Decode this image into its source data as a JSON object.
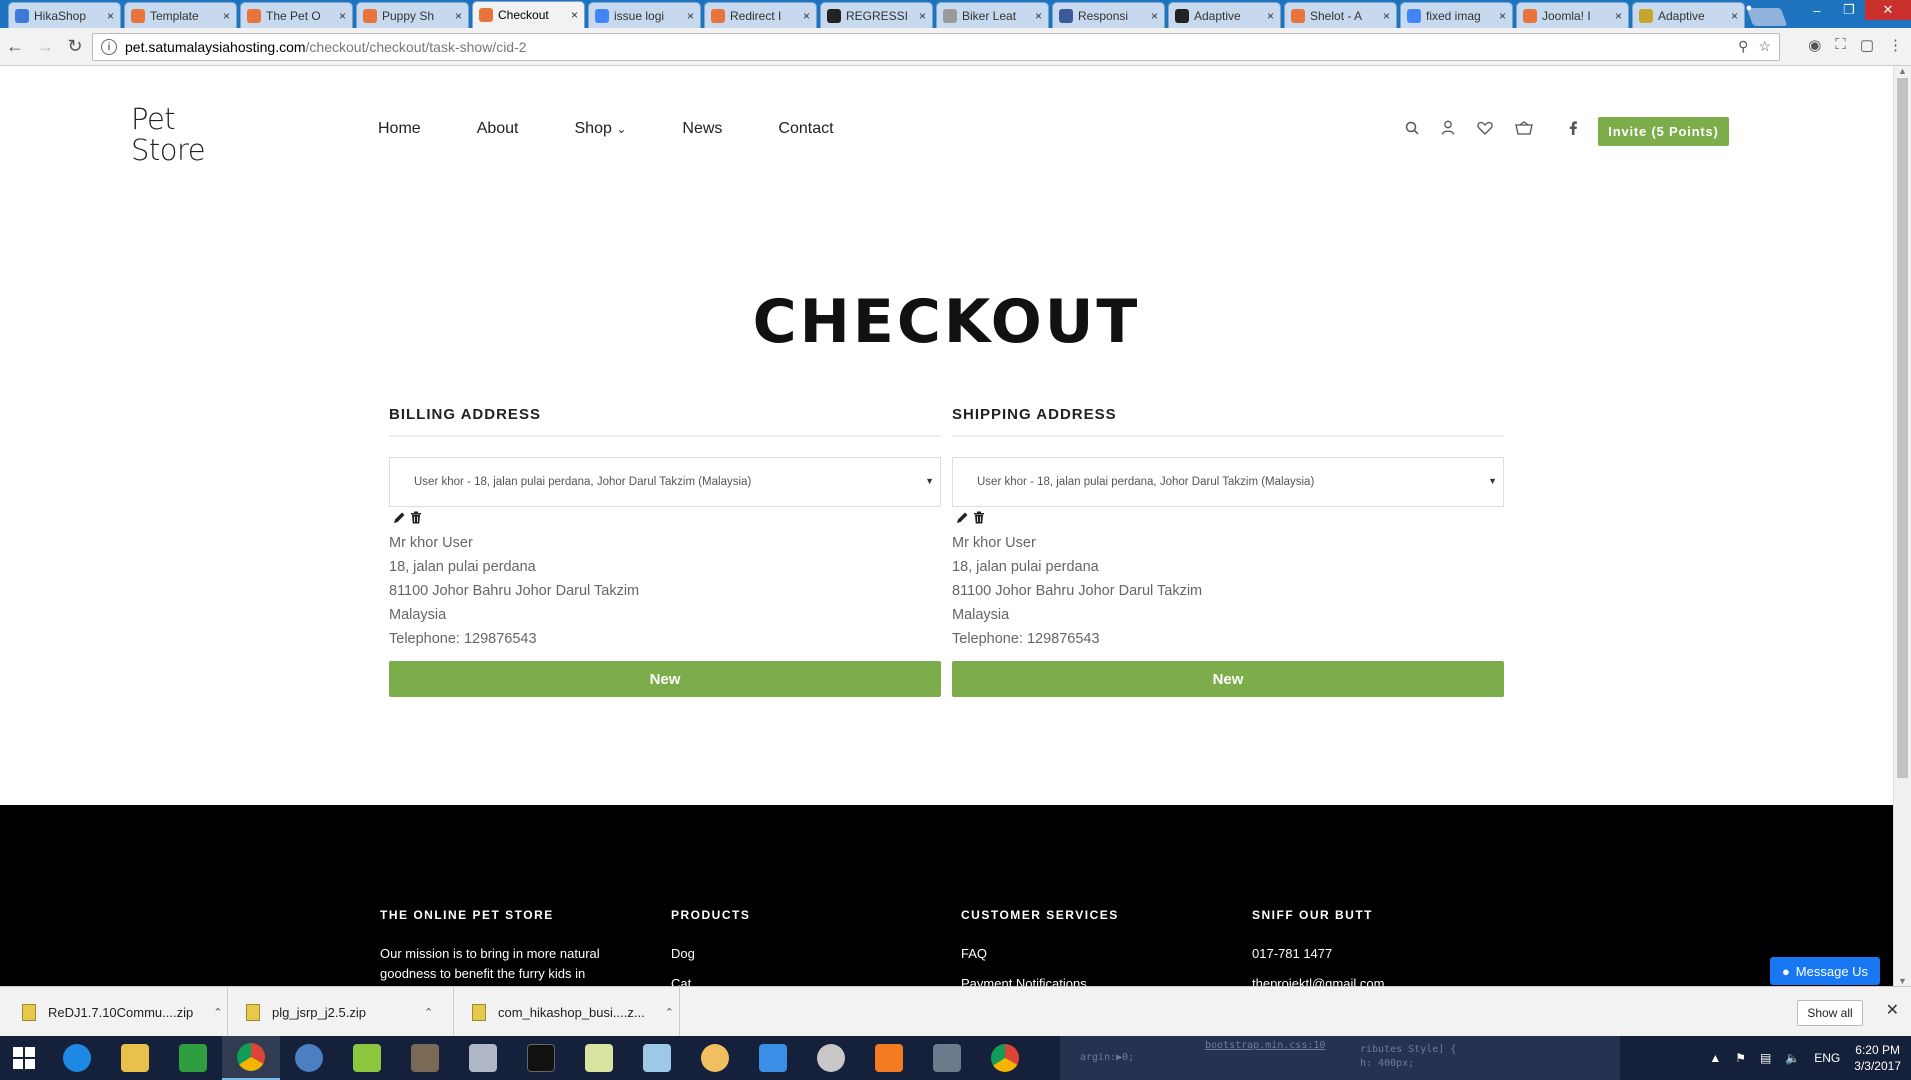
{
  "browser": {
    "tabs": [
      {
        "label": "HikaShop",
        "color": "#3a7bd5",
        "active": false
      },
      {
        "label": "Template",
        "color": "#e8743b",
        "active": false
      },
      {
        "label": "The Pet O",
        "color": "#e8743b",
        "active": false
      },
      {
        "label": "Puppy Sh",
        "color": "#e8743b",
        "active": false
      },
      {
        "label": "Checkout",
        "color": "#e8743b",
        "active": true
      },
      {
        "label": "issue logi",
        "color": "#4285f4",
        "active": false
      },
      {
        "label": "Redirect I",
        "color": "#e8743b",
        "active": false
      },
      {
        "label": "REGRESSI",
        "color": "#222222",
        "active": false
      },
      {
        "label": "Biker Leat",
        "color": "#999999",
        "active": false
      },
      {
        "label": "Responsi",
        "color": "#3b5998",
        "active": false
      },
      {
        "label": "Adaptive",
        "color": "#222222",
        "active": false
      },
      {
        "label": "Shelot - A",
        "color": "#e8743b",
        "active": false
      },
      {
        "label": "fixed imag",
        "color": "#4285f4",
        "active": false
      },
      {
        "label": "Joomla! I",
        "color": "#e8743b",
        "active": false
      },
      {
        "label": "Adaptive",
        "color": "#c7a42a",
        "active": false
      }
    ],
    "url_host": "pet.satumalaysiahosting.com",
    "url_path": "/checkout/checkout/task-show/cid-2"
  },
  "site": {
    "logo_line1": "Pet",
    "logo_line2": "Store",
    "nav": [
      "Home",
      "About",
      "Shop",
      "News",
      "Contact"
    ],
    "shop_caret": "⌄",
    "invite_label": "Invite (5 Points)",
    "accent_color": "#7cad4a"
  },
  "checkout": {
    "title": "CHECKOUT",
    "billing": {
      "heading": "BILLING ADDRESS",
      "selected": "User khor - 18, jalan pulai perdana, Johor Darul Takzim (Malaysia)",
      "name": "Mr khor User",
      "street": "18, jalan pulai perdana",
      "city": "81100 Johor Bahru Johor Darul Takzim",
      "country": "Malaysia",
      "phone": "Telephone: 129876543",
      "new_label": "New"
    },
    "shipping": {
      "heading": "SHIPPING ADDRESS",
      "selected": "User khor - 18, jalan pulai perdana, Johor Darul Takzim (Malaysia)",
      "name": "Mr khor User",
      "street": "18, jalan pulai perdana",
      "city": "81100 Johor Bahru Johor Darul Takzim",
      "country": "Malaysia",
      "phone": "Telephone: 129876543",
      "new_label": "New"
    }
  },
  "footer": {
    "col1": {
      "heading": "THE ONLINE PET STORE",
      "text": "Our mission is to bring in more natural goodness to benefit the furry kids in Malaysia"
    },
    "col2": {
      "heading": "PRODUCTS",
      "items": [
        "Dog",
        "Cat"
      ]
    },
    "col3": {
      "heading": "CUSTOMER SERVICES",
      "items": [
        "FAQ",
        "Payment Notifications"
      ]
    },
    "col4": {
      "heading": "SNIFF OUR BUTT",
      "items": [
        "017-781 1477",
        "theprojektl@gmail.com"
      ]
    }
  },
  "messenger_label": "Message Us",
  "downloads": {
    "items": [
      "ReDJ1.7.10Commu....zip",
      "plg_jsrp_j2.5.zip",
      "com_hikashop_busi....z..."
    ],
    "show_all": "Show all"
  },
  "taskbar": {
    "lang": "ENG",
    "time": "6:20 PM",
    "date": "3/3/2017",
    "ghost_text_1": "bootstrap.min.css:10",
    "ghost_text_2": "argin:▶0;",
    "ghost_text_3": "ributes Style] {",
    "ghost_text_4": "h: 400px;"
  }
}
